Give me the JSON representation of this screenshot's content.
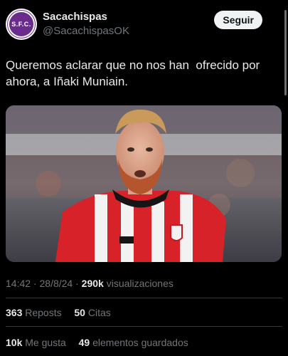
{
  "account": {
    "display_name": "Sacachispas",
    "handle": "@SacachispasOK",
    "avatar_text": "S.F.C.",
    "brand_color": "#6a2c8c"
  },
  "header": {
    "follow_label": "Seguir"
  },
  "tweet": {
    "text": "Queremos aclarar que no nos han  ofrecido por ahora, a Iñaki Muniain.",
    "image": "photo-soccer-player-red-white-jersey"
  },
  "meta": {
    "time": "14:42",
    "separator": " · ",
    "date": "28/8/24",
    "views_count": "290k",
    "views_label": "visualizaciones"
  },
  "stats": {
    "reposts_count": "363",
    "reposts_label": "Reposts",
    "quotes_count": "50",
    "quotes_label": "Citas",
    "likes_count": "10k",
    "likes_label": "Me gusta",
    "bookmarks_count": "49",
    "bookmarks_label": "elementos guardados"
  }
}
